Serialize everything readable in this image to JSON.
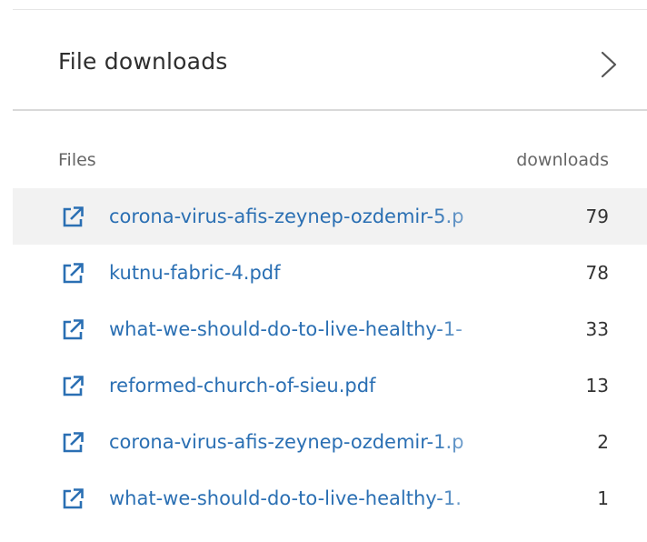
{
  "panel": {
    "title": "File downloads",
    "chevron_icon": "chevron-right-icon"
  },
  "table": {
    "headers": {
      "files": "Files",
      "downloads": "downloads"
    },
    "rows": [
      {
        "file": "corona-virus-afis-zeynep-ozdemir-5.p",
        "downloads": "79"
      },
      {
        "file": "kutnu-fabric-4.pdf",
        "downloads": "78"
      },
      {
        "file": "what-we-should-do-to-live-healthy-1-",
        "downloads": "33"
      },
      {
        "file": "reformed-church-of-sieu.pdf",
        "downloads": "13"
      },
      {
        "file": "corona-virus-afis-zeynep-ozdemir-1.p",
        "downloads": "2"
      },
      {
        "file": "what-we-should-do-to-live-healthy-1.",
        "downloads": "1"
      }
    ],
    "row_icon": "external-link-icon",
    "highlighted_row": 0
  },
  "colors": {
    "link": "#2a6fb3",
    "icon": "#2a6fb3",
    "highlight": "#f2f2f2",
    "divider": "#d9d9d9"
  }
}
